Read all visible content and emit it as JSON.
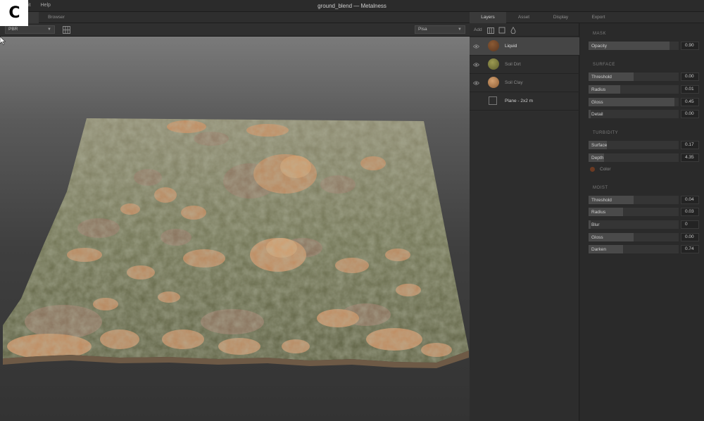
{
  "logo": {
    "letter": "C"
  },
  "menu": {
    "items": [
      "it",
      "Help"
    ]
  },
  "window": {
    "title": "ground_blend — Metalness"
  },
  "left_tabs": [
    "",
    "Browser"
  ],
  "viewport_toolbar": {
    "mode_select": "PBR",
    "env_select": "Pisa"
  },
  "right_tabs": [
    "Layers",
    "Asset",
    "Display",
    "Export"
  ],
  "layers": {
    "add_label": "Add",
    "items": [
      {
        "name": "Liquid",
        "thumb_color": "#7a4a2a",
        "selected": true
      },
      {
        "name": "Soil Dirt",
        "thumb_color": "#7a7a3a",
        "selected": false
      },
      {
        "name": "Soil Clay",
        "thumb_color": "#b07a4a",
        "selected": false
      },
      {
        "name": "Plane - 2x2 m",
        "thumb_color": "",
        "selected": false
      }
    ]
  },
  "properties": {
    "mask": {
      "title": "MASK",
      "sliders": [
        {
          "label": "Opacity",
          "value": "0.90",
          "fraction": 0.9
        }
      ]
    },
    "surface": {
      "title": "SURFACE",
      "sliders": [
        {
          "label": "Threshold",
          "value": "0.00",
          "fraction": 0.5
        },
        {
          "label": "Radius",
          "value": "0.01",
          "fraction": 0.35
        },
        {
          "label": "Gloss",
          "value": "0.45",
          "fraction": 0.95
        },
        {
          "label": "Detail",
          "value": "0.00",
          "fraction": 0.02
        }
      ]
    },
    "turbidity": {
      "title": "TURBIDITY",
      "sliders": [
        {
          "label": "Surface",
          "value": "0.17",
          "fraction": 0.2
        },
        {
          "label": "Depth",
          "value": "4.35",
          "fraction": 0.17
        }
      ],
      "color_label": "Color",
      "color": "#6b3a22"
    },
    "moist": {
      "title": "MOIST",
      "sliders": [
        {
          "label": "Threshold",
          "value": "0.04",
          "fraction": 0.5
        },
        {
          "label": "Radius",
          "value": "0.03",
          "fraction": 0.38
        },
        {
          "label": "Blur",
          "value": "0",
          "fraction": 0.02
        },
        {
          "label": "Gloss",
          "value": "0.00",
          "fraction": 0.5
        },
        {
          "label": "Darken",
          "value": "0.74",
          "fraction": 0.38
        }
      ]
    }
  },
  "colors": {
    "terrain_grass": "#6e7350",
    "terrain_mud": "#8a6a52",
    "terrain_clay": "#c0865a"
  }
}
